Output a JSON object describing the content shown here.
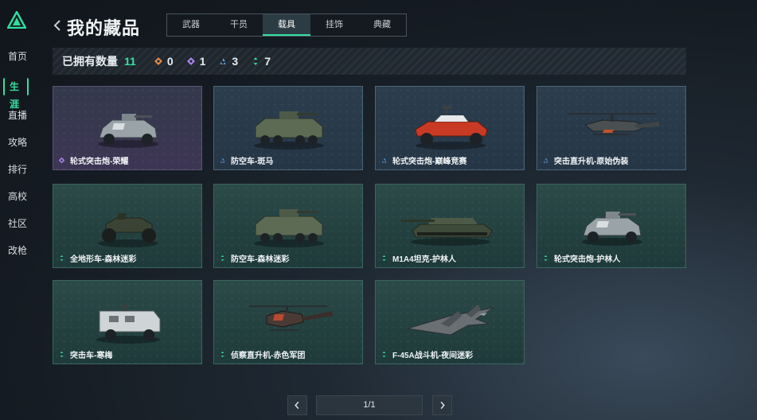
{
  "app": {
    "title": "我的藏品"
  },
  "sidebar": {
    "items": [
      {
        "label": "首页",
        "active": false
      },
      {
        "label": "生涯",
        "active": true
      },
      {
        "label": "直播",
        "active": false
      },
      {
        "label": "攻略",
        "active": false
      },
      {
        "label": "排行",
        "active": false
      },
      {
        "label": "高校",
        "active": false
      },
      {
        "label": "社区",
        "active": false
      },
      {
        "label": "改枪",
        "active": false
      }
    ]
  },
  "tabs": [
    {
      "label": "武器",
      "active": false
    },
    {
      "label": "干员",
      "active": false
    },
    {
      "label": "载具",
      "active": true
    },
    {
      "label": "挂饰",
      "active": false
    },
    {
      "label": "典藏",
      "active": false
    }
  ],
  "stats": {
    "label": "已拥有数量",
    "total": "11",
    "items": [
      {
        "icon": "orange-rarity-icon",
        "color": "#e0874a",
        "count": "0"
      },
      {
        "icon": "purple-rarity-icon",
        "color": "#a884e8",
        "count": "1"
      },
      {
        "icon": "blue-rarity-icon",
        "color": "#5aa6e8",
        "count": "3"
      },
      {
        "icon": "green-rarity-icon",
        "color": "#35d39a",
        "count": "7"
      }
    ]
  },
  "vehicles": [
    {
      "name": "轮式突击炮-荣耀",
      "rarity": "purple",
      "icon": "armored-car-icon"
    },
    {
      "name": "防空车-斑马",
      "rarity": "blue",
      "icon": "apc-icon"
    },
    {
      "name": "轮式突击炮-巅峰竞赛",
      "rarity": "blue",
      "icon": "buggy-icon"
    },
    {
      "name": "突击直升机-原始伪装",
      "rarity": "blue",
      "icon": "attack-helicopter-icon"
    },
    {
      "name": "全地形车-森林迷彩",
      "rarity": "green",
      "icon": "atv-icon"
    },
    {
      "name": "防空车-森林迷彩",
      "rarity": "green",
      "icon": "apc-icon"
    },
    {
      "name": "M1A4坦克-护林人",
      "rarity": "green",
      "icon": "tank-icon"
    },
    {
      "name": "轮式突击炮-护林人",
      "rarity": "green",
      "icon": "armored-car-icon"
    },
    {
      "name": "突击车-寒梅",
      "rarity": "green",
      "icon": "armored-truck-icon"
    },
    {
      "name": "侦察直升机-赤色军团",
      "rarity": "green",
      "icon": "scout-helicopter-icon"
    },
    {
      "name": "F-45A战斗机-夜间迷彩",
      "rarity": "green",
      "icon": "fighter-jet-icon"
    }
  ],
  "pager": {
    "text": "1/1"
  },
  "colors": {
    "accent": "#35e0a0"
  }
}
